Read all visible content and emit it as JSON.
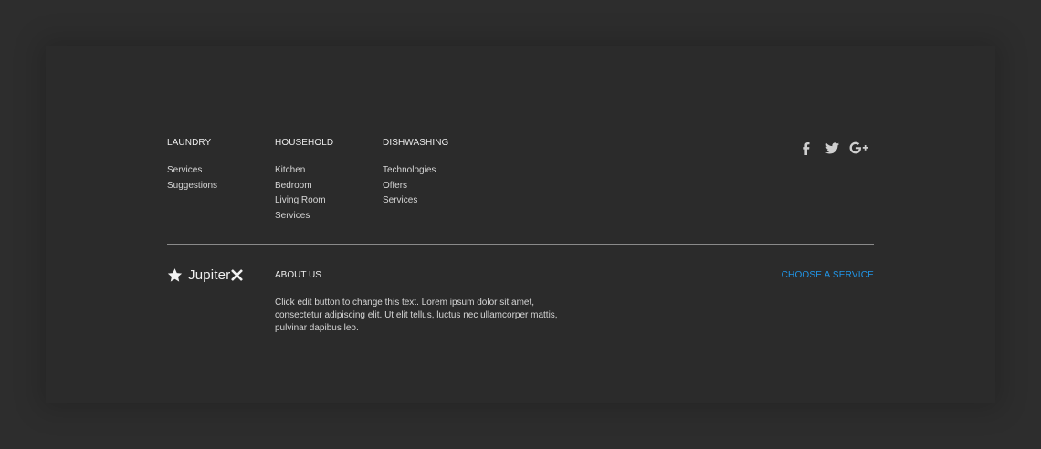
{
  "columns": [
    {
      "title": "LAUNDRY",
      "links": [
        "Services",
        "Suggestions"
      ]
    },
    {
      "title": "HOUSEHOLD",
      "links": [
        "Kitchen",
        "Bedroom",
        "Living Room",
        "Services"
      ]
    },
    {
      "title": "DISHWASHING",
      "links": [
        "Technologies",
        "Offers",
        "Services"
      ]
    }
  ],
  "social": {
    "icons": [
      "facebook-icon",
      "twitter-icon",
      "google-plus-icon"
    ]
  },
  "brand": {
    "name": "Jupiter",
    "icon": "star-icon"
  },
  "about": {
    "title": "ABOUT US",
    "text": "Click edit button to change this text. Lorem ipsum dolor sit amet, consectetur adipiscing elit. Ut elit tellus, luctus nec ullamcorper mattis, pulvinar dapibus leo."
  },
  "cta": {
    "label": "CHOOSE A SERVICE"
  },
  "colors": {
    "background": "#2b2b2b",
    "accent": "#2196e8",
    "text": "#d6d6d6"
  }
}
